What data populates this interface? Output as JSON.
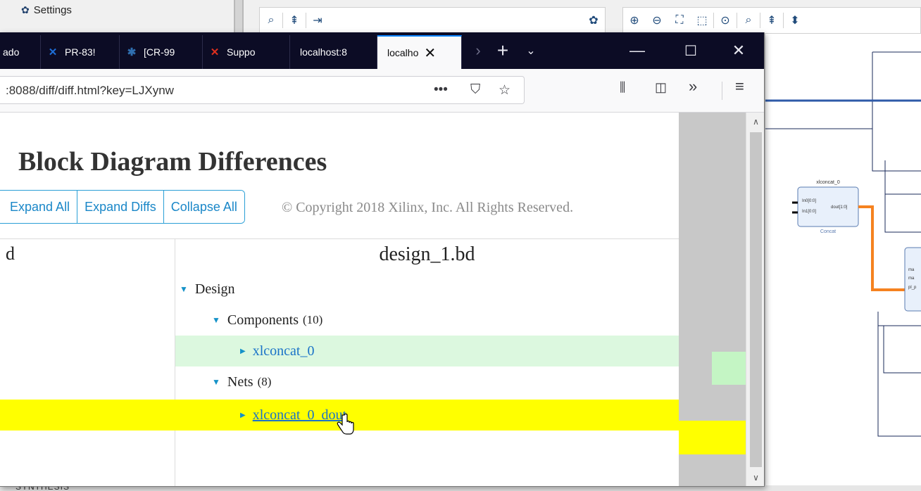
{
  "ide": {
    "settings_label": "Settings",
    "bottom_text": "SYNTHESIS",
    "diagram": {
      "block_title": "xlconcat_0",
      "ports": [
        "In0[0:0]",
        "In1[0:0]"
      ],
      "output": "dout[1:0]",
      "block_sub": "Concat",
      "right_ports": [
        "ma",
        "ma",
        "pl_p"
      ]
    }
  },
  "browser": {
    "tabs": [
      {
        "label": "ado",
        "icon": "partial-tab-icon"
      },
      {
        "label": "PR-83!",
        "icon": "xilinx-x-icon"
      },
      {
        "label": "[CR-99",
        "icon": "bug-icon"
      },
      {
        "label": "Suppo",
        "icon": "xilinx-support-icon"
      },
      {
        "label": "localhost:8",
        "icon": ""
      },
      {
        "label": "localho",
        "icon": ""
      }
    ],
    "url": ":8088/diff/diff.html?key=LJXynw"
  },
  "page": {
    "title": "Block Diagram Differences",
    "buttons": {
      "expand_all": "Expand All",
      "expand_diffs": "Expand Diffs",
      "collapse_all": "Collapse All"
    },
    "copyright": "© Copyright 2018 Xilinx, Inc. All Rights Reserved.",
    "left_header": "d",
    "right_header": "design_1.bd",
    "tree": {
      "design": "Design",
      "components": "Components",
      "components_count": "(10)",
      "component_item": "xlconcat_0",
      "nets": "Nets",
      "nets_count": "(8)",
      "net_item": "xlconcat_0_dout"
    }
  },
  "colors": {
    "tab_bar": "#0c0c25",
    "added_row": "#dcf8df",
    "changed_row": "#ffff00",
    "link": "#1a73c8",
    "accent_orange": "#f58220"
  }
}
